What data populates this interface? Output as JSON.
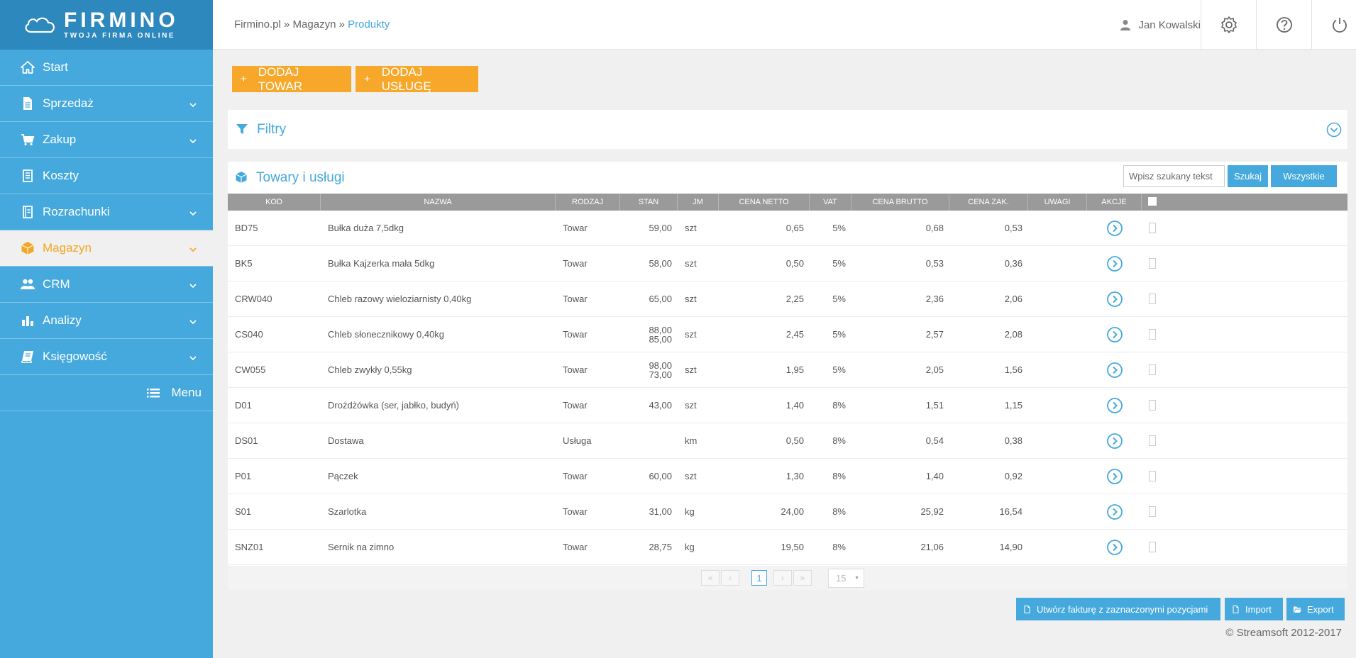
{
  "brand": {
    "name": "FIRMINO",
    "tagline": "TWOJA FIRMA ONLINE"
  },
  "sidebar": {
    "items": [
      {
        "label": "Start",
        "icon": "home-icon",
        "has_submenu": false
      },
      {
        "label": "Sprzedaż",
        "icon": "document-icon",
        "has_submenu": true
      },
      {
        "label": "Zakup",
        "icon": "cart-icon",
        "has_submenu": true
      },
      {
        "label": "Koszty",
        "icon": "receipt-icon",
        "has_submenu": false
      },
      {
        "label": "Rozrachunki",
        "icon": "ledger-icon",
        "has_submenu": true
      },
      {
        "label": "Magazyn",
        "icon": "box-icon",
        "has_submenu": true,
        "active": true
      },
      {
        "label": "CRM",
        "icon": "users-icon",
        "has_submenu": true
      },
      {
        "label": "Analizy",
        "icon": "bar-chart-icon",
        "has_submenu": true
      },
      {
        "label": "Księgowość",
        "icon": "book-icon",
        "has_submenu": true
      }
    ],
    "menu_label": "Menu"
  },
  "header": {
    "breadcrumb": {
      "part1": "Firmino.pl",
      "sep1": " » ",
      "part2": "Magazyn",
      "sep2": " » ",
      "current": "Produkty"
    },
    "user_name": "Jan Kowalski"
  },
  "toolbar": {
    "add_product": "DODAJ TOWAR",
    "add_service": "DODAJ USŁUGĘ",
    "plus": "+"
  },
  "filters": {
    "title": "Filtry"
  },
  "products": {
    "title": "Towary i usługi",
    "search_placeholder": "Wpisz szukany tekst",
    "search_button": "Szukaj",
    "all_button": "Wszystkie",
    "columns": [
      "KOD",
      "NAZWA",
      "RODZAJ",
      "STAN",
      "JM",
      "CENA NETTO",
      "VAT",
      "CENA BRUTTO",
      "CENA ZAK.",
      "UWAGI",
      "AKCJE"
    ],
    "rows": [
      {
        "kod": "BD75",
        "nazwa": "Bułka duża 7,5dkg",
        "rodzaj": "Towar",
        "stan": [
          "59,00"
        ],
        "jm": "szt",
        "netto": "0,65",
        "vat": "5%",
        "brutto": "0,68",
        "zak": "0,53",
        "uwagi": ""
      },
      {
        "kod": "BK5",
        "nazwa": "Bułka Kajzerka mała 5dkg",
        "rodzaj": "Towar",
        "stan": [
          "58,00"
        ],
        "jm": "szt",
        "netto": "0,50",
        "vat": "5%",
        "brutto": "0,53",
        "zak": "0,36",
        "uwagi": ""
      },
      {
        "kod": "CRW040",
        "nazwa": "Chleb razowy wieloziarnisty 0,40kg",
        "rodzaj": "Towar",
        "stan": [
          "65,00"
        ],
        "jm": "szt",
        "netto": "2,25",
        "vat": "5%",
        "brutto": "2,36",
        "zak": "2,06",
        "uwagi": ""
      },
      {
        "kod": "CS040",
        "nazwa": "Chleb słonecznikowy 0,40kg",
        "rodzaj": "Towar",
        "stan": [
          "88,00",
          "85,00"
        ],
        "jm": "szt",
        "netto": "2,45",
        "vat": "5%",
        "brutto": "2,57",
        "zak": "2,08",
        "uwagi": ""
      },
      {
        "kod": "CW055",
        "nazwa": "Chleb zwykły 0,55kg",
        "rodzaj": "Towar",
        "stan": [
          "98,00",
          "73,00"
        ],
        "jm": "szt",
        "netto": "1,95",
        "vat": "5%",
        "brutto": "2,05",
        "zak": "1,56",
        "uwagi": ""
      },
      {
        "kod": "D01",
        "nazwa": "Drożdżówka (ser, jabłko, budyń)",
        "rodzaj": "Towar",
        "stan": [
          "43,00"
        ],
        "jm": "szt",
        "netto": "1,40",
        "vat": "8%",
        "brutto": "1,51",
        "zak": "1,15",
        "uwagi": ""
      },
      {
        "kod": "DS01",
        "nazwa": "Dostawa",
        "rodzaj": "Usługa",
        "stan": [],
        "jm": "km",
        "netto": "0,50",
        "vat": "8%",
        "brutto": "0,54",
        "zak": "0,38",
        "uwagi": ""
      },
      {
        "kod": "P01",
        "nazwa": "Pączek",
        "rodzaj": "Towar",
        "stan": [
          "60,00"
        ],
        "jm": "szt",
        "netto": "1,30",
        "vat": "8%",
        "brutto": "1,40",
        "zak": "0,92",
        "uwagi": ""
      },
      {
        "kod": "S01",
        "nazwa": "Szarlotka",
        "rodzaj": "Towar",
        "stan": [
          "31,00"
        ],
        "jm": "kg",
        "netto": "24,00",
        "vat": "8%",
        "brutto": "25,92",
        "zak": "16,54",
        "uwagi": ""
      },
      {
        "kod": "SNZ01",
        "nazwa": "Sernik na zimno",
        "rodzaj": "Towar",
        "stan": [
          "28,75"
        ],
        "jm": "kg",
        "netto": "19,50",
        "vat": "8%",
        "brutto": "21,06",
        "zak": "14,90",
        "uwagi": ""
      }
    ],
    "pager": {
      "first": "«",
      "prev": "‹",
      "current": "1",
      "next": "›",
      "last": "»",
      "per_page": "15"
    }
  },
  "footer": {
    "invoice_button": "Utwórz fakturę z zaznaczonymi pozycjami",
    "import_button": "Import",
    "export_button": "Export",
    "copyright": "© Streamsoft 2012-2017"
  },
  "colors": {
    "accent_blue": "#45a9dd",
    "header_blue": "#2d88bd",
    "accent_orange": "#f7a82a"
  }
}
